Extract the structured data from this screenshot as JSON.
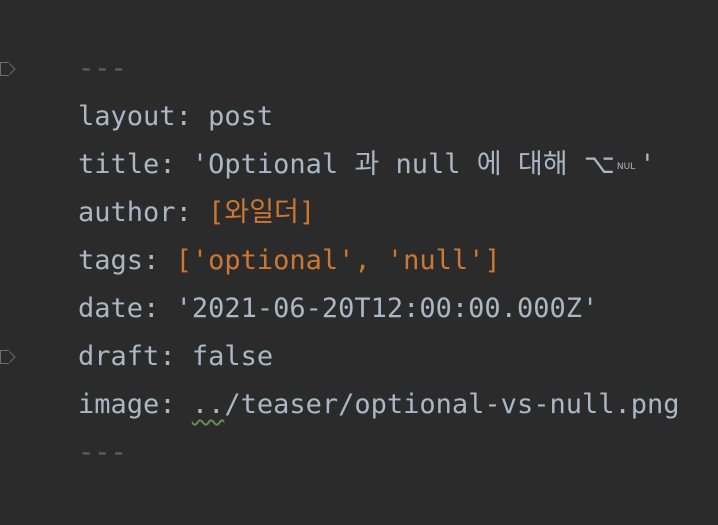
{
  "editor": {
    "separator_top": "---",
    "separator_bottom": "---",
    "lines": {
      "layout": {
        "key": "layout",
        "colon": ": ",
        "value": "post"
      },
      "title": {
        "key": "title",
        "colon": ": ",
        "value_prefix": "'Optional 과 null 에 대해 ",
        "special_glyph": "⌥",
        "nul_label": "NUL",
        "value_suffix": "'"
      },
      "author": {
        "key": "author",
        "colon": ": ",
        "value": "[와일더]"
      },
      "tags": {
        "key": "tags",
        "colon": ": ",
        "value": "['optional', 'null']"
      },
      "date": {
        "key": "date",
        "colon": ": ",
        "value": "'2021-06-20T12:00:00.000Z'"
      },
      "draft": {
        "key": "draft",
        "colon": ": ",
        "value": "false"
      },
      "image": {
        "key": "image",
        "colon": ": ",
        "value_dots": "..",
        "value_rest": "/teaser/optional-vs-null.png"
      }
    }
  },
  "colors": {
    "background": "#2b2b2b",
    "text": "#a9b7c6",
    "orange": "#cc7832",
    "separator": "#606366"
  },
  "icons": {
    "fold_top": "fold-marker-icon",
    "fold_bottom": "fold-marker-icon"
  }
}
